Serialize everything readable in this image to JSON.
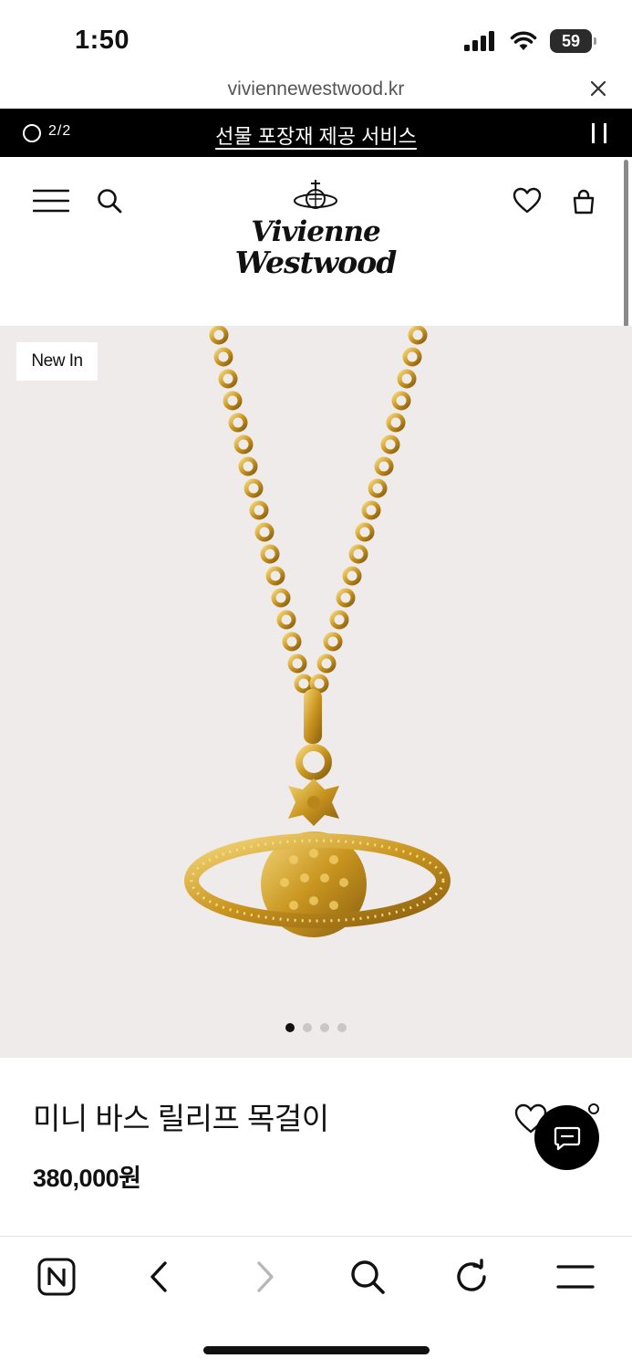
{
  "status_bar": {
    "time": "1:50",
    "battery": "59",
    "icons": [
      "signal-icon",
      "wifi-icon",
      "battery-icon"
    ]
  },
  "browser": {
    "url": "viviennewestwood.kr",
    "close_icon": "close-icon"
  },
  "promo": {
    "counter": "2/2",
    "text": "선물 포장재 제공 서비스",
    "pause_icon": "pause-icon"
  },
  "header": {
    "logo_line1": "Vivienne",
    "logo_line2": "Westwood",
    "icons": [
      "menu-icon",
      "search-icon",
      "heart-icon",
      "bag-icon"
    ]
  },
  "hero": {
    "badge": "New In",
    "background": "#efebea",
    "slides_total": 4,
    "active_slide": 1
  },
  "product": {
    "name": "미니 바스 릴리프 목걸이",
    "price": "380,000원"
  },
  "browser_nav": {
    "items": [
      "naver-home-icon",
      "back-icon",
      "forward-icon",
      "search-icon",
      "refresh-icon",
      "menu-icon"
    ]
  },
  "colors": {
    "accent": "#000000",
    "gold": "#d4a532",
    "hero_bg": "#efebea"
  }
}
